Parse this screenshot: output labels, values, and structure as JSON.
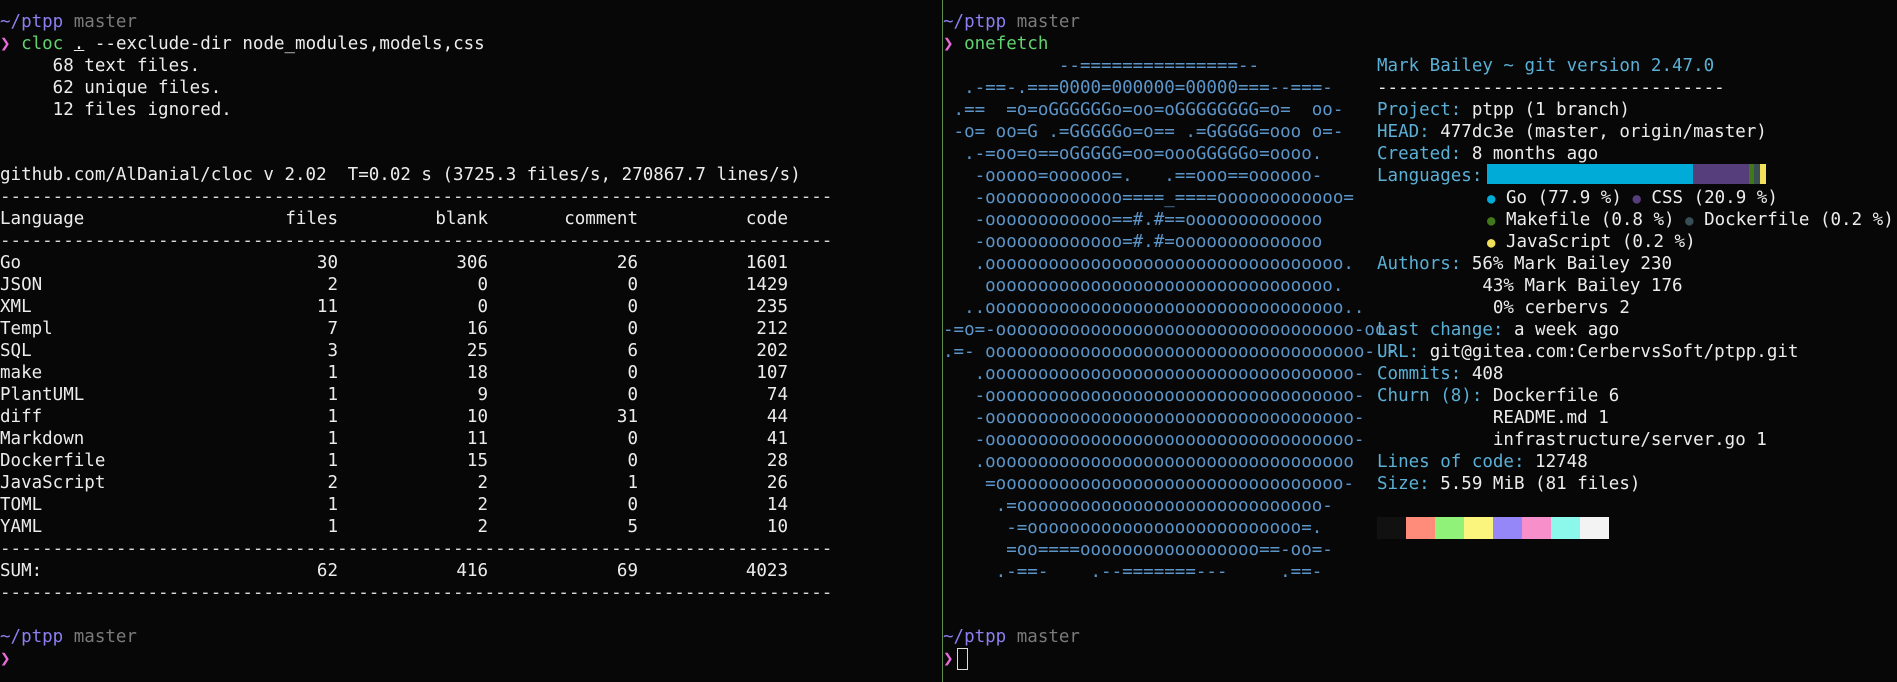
{
  "left": {
    "prompt_top": {
      "dir": "~/ptpp",
      "branch": " master",
      "arrow": "❯"
    },
    "command": {
      "name": "cloc",
      "dot": ".",
      "args": " --exclude-dir node_modules,models,css"
    },
    "summary": [
      "     68 text files.",
      "     62 unique files.",
      "     12 files ignored."
    ],
    "header_line": "github.com/AlDanial/cloc v 2.02  T=0.02 s (3725.3 files/s, 270867.7 lines/s)",
    "separator": "-------------------------------------------------------------------------------",
    "columns": [
      "Language",
      "files",
      "blank",
      "comment",
      "code"
    ],
    "rows": [
      {
        "lang": "Go",
        "files": "30",
        "blank": "306",
        "comment": "26",
        "code": "1601"
      },
      {
        "lang": "JSON",
        "files": "2",
        "blank": "0",
        "comment": "0",
        "code": "1429"
      },
      {
        "lang": "XML",
        "files": "11",
        "blank": "0",
        "comment": "0",
        "code": "235"
      },
      {
        "lang": "Templ",
        "files": "7",
        "blank": "16",
        "comment": "0",
        "code": "212"
      },
      {
        "lang": "SQL",
        "files": "3",
        "blank": "25",
        "comment": "6",
        "code": "202"
      },
      {
        "lang": "make",
        "files": "1",
        "blank": "18",
        "comment": "0",
        "code": "107"
      },
      {
        "lang": "PlantUML",
        "files": "1",
        "blank": "9",
        "comment": "0",
        "code": "74"
      },
      {
        "lang": "diff",
        "files": "1",
        "blank": "10",
        "comment": "31",
        "code": "44"
      },
      {
        "lang": "Markdown",
        "files": "1",
        "blank": "11",
        "comment": "0",
        "code": "41"
      },
      {
        "lang": "Dockerfile",
        "files": "1",
        "blank": "15",
        "comment": "0",
        "code": "28"
      },
      {
        "lang": "JavaScript",
        "files": "2",
        "blank": "2",
        "comment": "1",
        "code": "26"
      },
      {
        "lang": "TOML",
        "files": "1",
        "blank": "2",
        "comment": "0",
        "code": "14"
      },
      {
        "lang": "YAML",
        "files": "1",
        "blank": "2",
        "comment": "5",
        "code": "10"
      }
    ],
    "sum": {
      "lang": "SUM:",
      "files": "62",
      "blank": "416",
      "comment": "69",
      "code": "4023"
    },
    "prompt_bottom": {
      "dir": "~/ptpp",
      "branch": " master",
      "arrow": "❯"
    }
  },
  "right": {
    "prompt_top": {
      "dir": "~/ptpp",
      "branch": " master",
      "arrow": "❯"
    },
    "command": "onefetch",
    "ascii": [
      "           --===============--",
      "  .-==-.===0000=000000=00000===--===-",
      " .==  =o=oGGGGGGo=oo=oGGGGGGGG=o=  oo-",
      " -o= oo=G .=GGGGGo=o== .=GGGGG=ooo o=-",
      "  .-=oo=o==oGGGGG=oo=oooGGGGGo=oooo.",
      "   -ooooo=oooooo=.   .==ooo==oooooo-",
      "   -ooooooooooooo====_====oooooooooooo=",
      "   -oooooooooooo==#.#==ooooooooooooo",
      "   -ooooooooooooo=#.#=oooooooooooooo",
      "   .oooooooooooooooooooooooooooooooooo.",
      "    ooooooooooooooooooooooooooooooooo.",
      "  ..oooooooooooooooooooooooooooooooooo..",
      "-=o=-oooooooooooooooooooooooooooooooooo-oo.",
      ".=- oooooooooooooooooooooooooooooooooooo-.-",
      "   .ooooooooooooooooooooooooooooooooooo-",
      "   -ooooooooooooooooooooooooooooooooooo-",
      "   -ooooooooooooooooooooooooooooooooooo-",
      "   -ooooooooooooooooooooooooooooooooooo-",
      "   .ooooooooooooooooooooooooooooooooooo",
      "    =ooooooooooooooooooooooooooooooooo-",
      "     .=ooooooooooooooooooooooooooooo-",
      "      -=oooooooooooooooooooooooooo=.",
      "      =oo====ooooooooooooooooo==-oo=-",
      "     .-==-    .--=======---     .==-"
    ],
    "title": "Mark Bailey ~ git version 2.47.0",
    "underline": "---------------------------------",
    "fields": {
      "project": {
        "k": "Project:",
        "v": " ptpp (1 branch)"
      },
      "head": {
        "k": "HEAD:",
        "v": " 477dc3e (master, origin/master)"
      },
      "created": {
        "k": "Created:",
        "v": " 8 months ago"
      },
      "languages": {
        "k": "Languages:"
      },
      "authors": {
        "k": "Authors:",
        "v1": " 56% Mark Bailey 230",
        "v2": "          43% Mark Bailey 176",
        "v3": "           0% cerbervs 2"
      },
      "last_change": {
        "k": "Last change:",
        "v": " a week ago"
      },
      "url": {
        "k": "URL:",
        "v": " git@gitea.com:CerbervsSoft/ptpp.git"
      },
      "commits": {
        "k": "Commits:",
        "v": " 408"
      },
      "churn": {
        "k": "Churn (8):",
        "v1": " Dockerfile 6",
        "v2": "           README.md 1",
        "v3": "           infrastructure/server.go 1"
      },
      "loc": {
        "k": "Lines of code:",
        "v": " 12748"
      },
      "size": {
        "k": "Size:",
        "v": " 5.59 MiB (81 files)"
      }
    },
    "languages": [
      {
        "name": "Go",
        "label": "Go (77.9 %)",
        "pct": 77.9,
        "color": "#00acd7"
      },
      {
        "name": "CSS",
        "label": "CSS (20.9 %)",
        "pct": 20.9,
        "color": "#563d7c"
      },
      {
        "name": "Makefile",
        "label": "Makefile (0.8 %)",
        "pct": 0.8,
        "color": "#427819"
      },
      {
        "name": "Dockerfile",
        "label": "Dockerfile (0.2 %)",
        "pct": 0.2,
        "color": "#384d54"
      },
      {
        "name": "JavaScript",
        "label": "JavaScript (0.2 %)",
        "pct": 0.2,
        "color": "#f1e05a"
      }
    ],
    "palette": [
      "#111111",
      "#ff8b7a",
      "#90f279",
      "#fbf57d",
      "#9687f9",
      "#f78fcb",
      "#8cf8ec",
      "#f3f3f3"
    ],
    "prompt_bottom": {
      "dir": "~/ptpp",
      "branch": " master",
      "arrow": "❯"
    }
  }
}
